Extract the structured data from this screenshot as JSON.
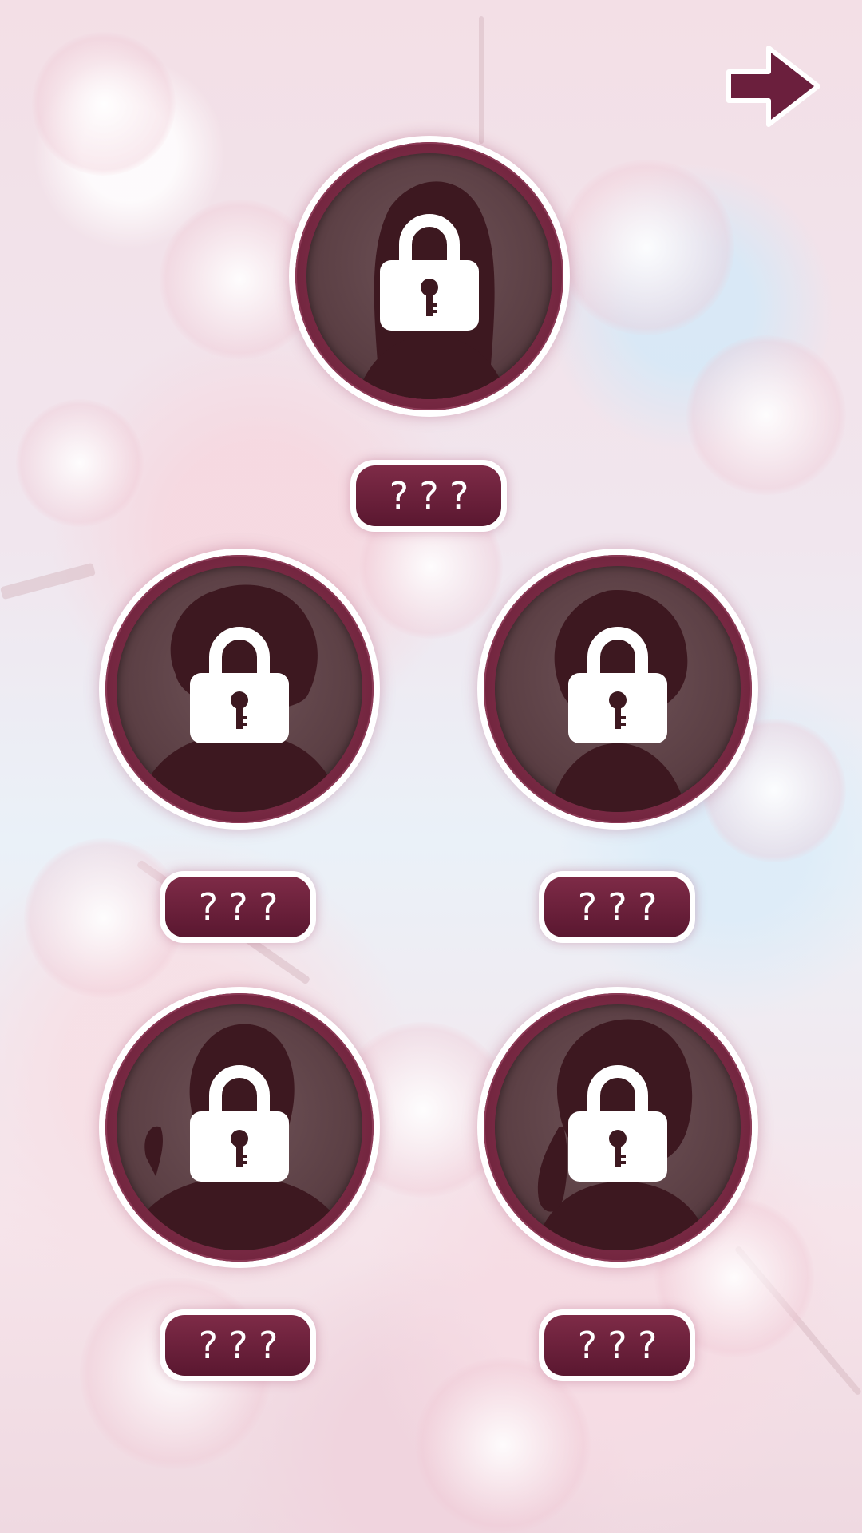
{
  "next_button": {
    "icon": "right-arrow-icon",
    "color": "#6b1f3d"
  },
  "colors": {
    "accent": "#6b1f3d",
    "silhouette": "#3d1820",
    "lock": "#ffffff"
  },
  "characters": [
    {
      "name": "???",
      "locked": true,
      "icon": "lock-icon",
      "silhouette": "long-hair-silhouette"
    },
    {
      "name": "???",
      "locked": true,
      "icon": "lock-icon",
      "silhouette": "messy-hair-silhouette"
    },
    {
      "name": "???",
      "locked": true,
      "icon": "lock-icon",
      "silhouette": "short-hair-silhouette"
    },
    {
      "name": "???",
      "locked": true,
      "icon": "lock-icon",
      "silhouette": "waving-silhouette"
    },
    {
      "name": "???",
      "locked": true,
      "icon": "lock-icon",
      "silhouette": "braid-silhouette"
    }
  ]
}
